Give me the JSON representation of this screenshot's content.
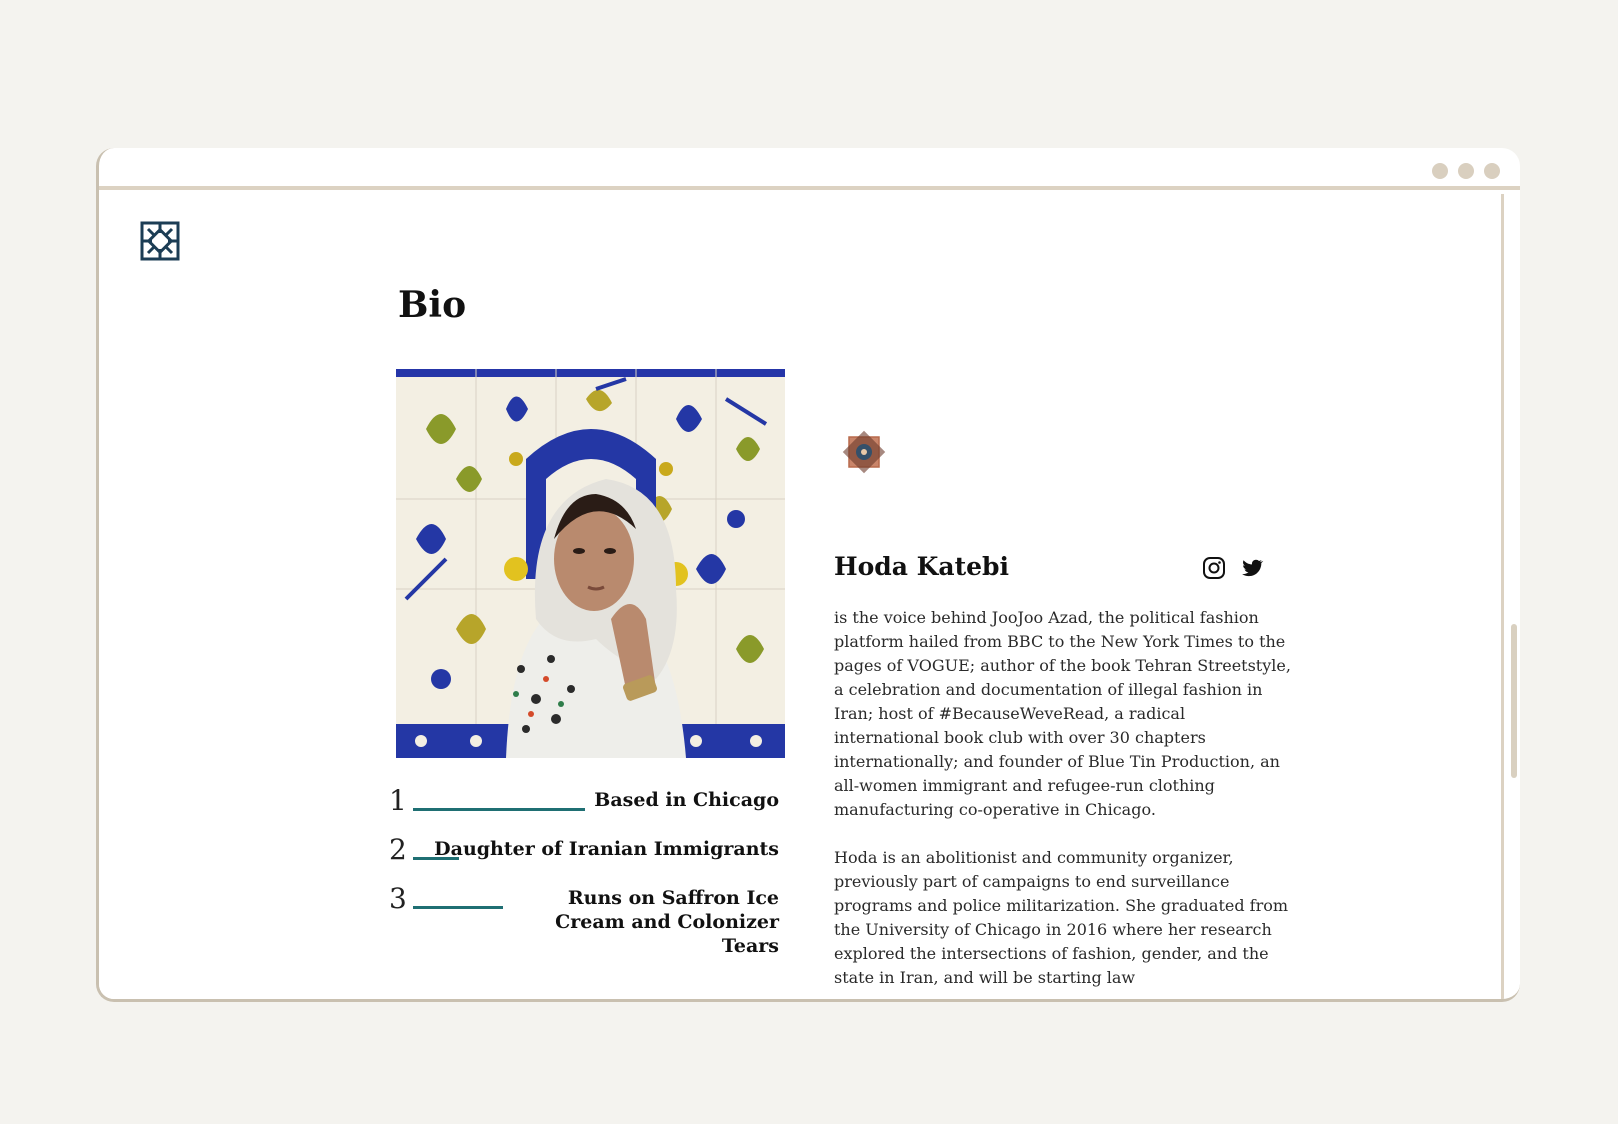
{
  "page": {
    "title": "Bio"
  },
  "person": {
    "name": "Hoda Katebi"
  },
  "facts": [
    {
      "num": "1",
      "text": "Based in Chicago"
    },
    {
      "num": "2",
      "text": "Daughter of Iranian Immigrants"
    },
    {
      "num": "3",
      "text": "Runs on Saffron Ice Cream and Colonizer Tears"
    }
  ],
  "bio": {
    "paragraph1": "is the voice behind JooJoo Azad, the political fashion platform hailed from BBC to the New York Times to the pages of VOGUE; author of the book Tehran Streetstyle, a celebration and documentation of illegal fashion in Iran; host of #BecauseWeveRead, a radical international book club with over 30 chapters internationally; and founder of Blue Tin Production, an all-women immigrant and refugee-run clothing manufacturing co-operative in Chicago.",
    "paragraph2": "Hoda is an abolitionist and community organizer, previously part of campaigns to end surveillance programs and police militarization. She graduated from the University of Chicago in 2016 where her research explored the intersections of fashion, gender, and the state in Iran, and will be starting law"
  },
  "social": {
    "icons": [
      "instagram-icon",
      "twitter-icon"
    ]
  },
  "colors": {
    "accent": "#1f6f73",
    "frame": "#dcd2c2",
    "background": "#f4f3ef"
  }
}
